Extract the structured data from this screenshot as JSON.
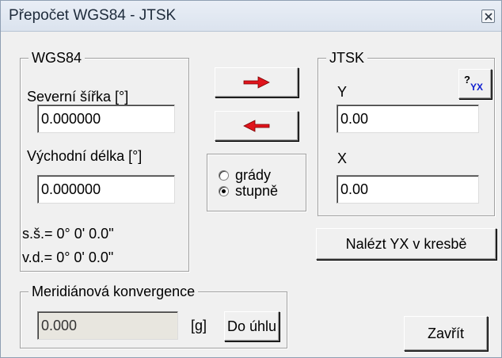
{
  "window": {
    "title": "Přepočet WGS84 - JTSK"
  },
  "wgs84": {
    "legend": "WGS84",
    "lat_label": "Severní šířka [°]",
    "lat_value": "0.000000",
    "lon_label": "Východní délka [°]",
    "lon_value": "0.000000",
    "lat_dms": "s.š.= 0° 0' 0.0\"",
    "lon_dms": "v.d.= 0° 0' 0.0\""
  },
  "jtsk": {
    "legend": "JTSK",
    "y_label": "Y",
    "y_value": "0.00",
    "x_label": "X",
    "x_value": "0.00",
    "swap_button_label": "?YX"
  },
  "units": {
    "options": [
      "grády",
      "stupně"
    ],
    "selected": "stupně"
  },
  "convergence": {
    "legend": "Meridiánová konvergence",
    "value": "0.000",
    "unit": "[g]",
    "to_angle_label": "Do úhlu"
  },
  "buttons": {
    "find_yx_label": "Nalézt YX v kresbě",
    "close_label": "Zavřít"
  },
  "colors": {
    "arrow_red": "#e0141c",
    "help_blue": "#1020d0"
  },
  "icons": {
    "to_jtsk": "red-right-arrow-icon",
    "to_wgs84": "red-left-arrow-icon",
    "close": "close-x-icon"
  }
}
